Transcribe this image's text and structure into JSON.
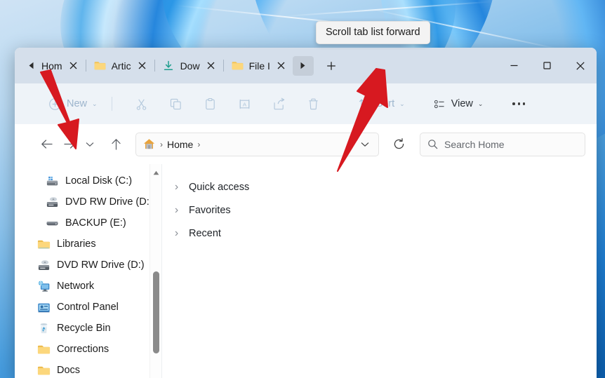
{
  "tooltip": {
    "text": "Scroll tab list forward"
  },
  "titlebar": {
    "scroll_back_label": "◀",
    "scroll_forward_label": "▶",
    "new_tab_label": "+",
    "tabs": [
      {
        "label": "Hom",
        "icon": "home-icon",
        "close_label": "✕"
      },
      {
        "label": "Artic",
        "icon": "folder-icon",
        "close_label": "✕"
      },
      {
        "label": "Dow",
        "icon": "downloads-icon",
        "close_label": "✕"
      },
      {
        "label": "File I",
        "icon": "folder-icon",
        "close_label": "✕"
      }
    ],
    "window_controls": {
      "minimize": "minimize-icon",
      "maximize": "maximize-icon",
      "close": "close-icon"
    }
  },
  "commandbar": {
    "new_label": "New",
    "new_chevron": "⌄",
    "cut_label": "cut-icon",
    "copy_label": "copy-icon",
    "paste_label": "paste-icon",
    "rename_label": "rename-icon",
    "share_label": "share-icon",
    "delete_label": "delete-icon",
    "sort_label": "Sort",
    "sort_chevron": "⌄",
    "view_label": "View",
    "view_chevron": "⌄",
    "more_label": "•••"
  },
  "addressbar": {
    "back_label": "←",
    "forward_label": "→",
    "recent_chevron": "⌄",
    "up_label": "↑",
    "crumb_home": "Home",
    "crumb_sep_1": "›",
    "crumb_sep_2": "›",
    "dropdown_chevron": "⌄",
    "refresh_label": "⟳",
    "search_placeholder": "Search Home"
  },
  "sidebar": {
    "items": [
      {
        "label": "Local Disk (C:)",
        "icon": "drive-icon",
        "indent": true
      },
      {
        "label": "DVD RW Drive (D:)",
        "icon": "dvd-drive-icon",
        "indent": true
      },
      {
        "label": "BACKUP (E:)",
        "icon": "external-drive-icon",
        "indent": true
      },
      {
        "label": "Libraries",
        "icon": "folder-icon",
        "indent": false
      },
      {
        "label": "DVD RW Drive (D:)",
        "icon": "dvd-drive-icon",
        "indent": false
      },
      {
        "label": "Network",
        "icon": "network-icon",
        "indent": false
      },
      {
        "label": "Control Panel",
        "icon": "control-panel-icon",
        "indent": false
      },
      {
        "label": "Recycle Bin",
        "icon": "recycle-bin-icon",
        "indent": false
      },
      {
        "label": "Corrections",
        "icon": "folder-icon",
        "indent": false
      },
      {
        "label": "Docs",
        "icon": "folder-icon",
        "indent": false
      }
    ],
    "scroll_up_label": "▲"
  },
  "content": {
    "groups": [
      {
        "label": "Quick access",
        "chevron": "›"
      },
      {
        "label": "Favorites",
        "chevron": "›"
      },
      {
        "label": "Recent",
        "chevron": "›"
      }
    ]
  },
  "colors": {
    "titlebar_bg": "#d5dfeb",
    "commandbar_bg": "#eef3f8",
    "annotation_red": "#d71920",
    "accent_teal": "#1f9e8e",
    "folder_yellow": "#f6c75a"
  }
}
